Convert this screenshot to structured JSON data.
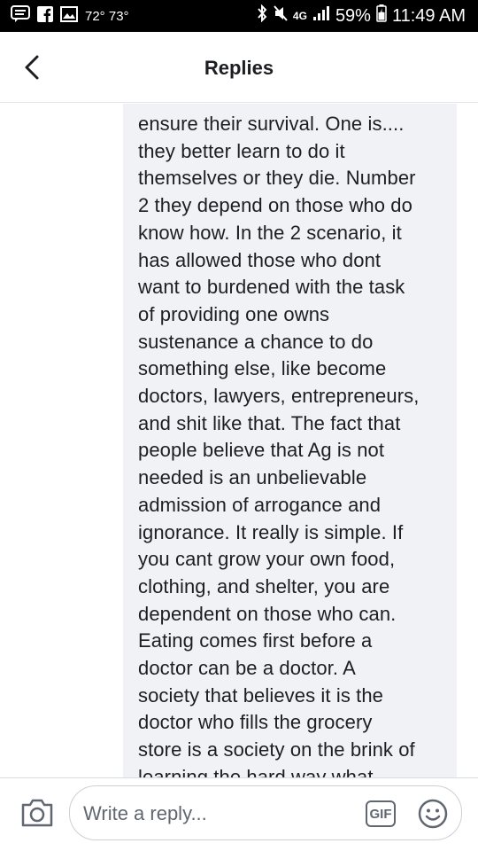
{
  "status_bar": {
    "temperature": "72° 73°",
    "network": "4G",
    "battery": "59%",
    "time": "11:49 AM"
  },
  "header": {
    "title": "Replies",
    "back_icon": "chevron-left-icon"
  },
  "comment": {
    "text": "ensure their survival. One is....\nthey better learn to do it\nthemselves or they die. Number\n2 they depend on those who do\nknow how. In the 2 scenario, it\nhas allowed those who dont\nwant to burdened with the task\nof providing one owns\nsustenance a chance to do\nsomething else, like become\ndoctors, lawyers, entrepreneurs,\nand shit like that. The fact that\npeople believe that Ag is not\nneeded is an unbelievable\nadmission of arrogance and\nignorance. It really is simple. If\nyou cant grow your own food,\nclothing, and shelter, you are\ndependent on those who can.\nEating comes first before a\ndoctor can be a doctor. A\nsociety that believes it is the\ndoctor who fills the grocery\nstore is a society on the brink of\nlearning the hard way what"
  },
  "composer": {
    "placeholder": "Write a reply...",
    "gif_label": "GIF",
    "camera_icon": "camera-icon",
    "emoji_icon": "smiley-icon"
  }
}
